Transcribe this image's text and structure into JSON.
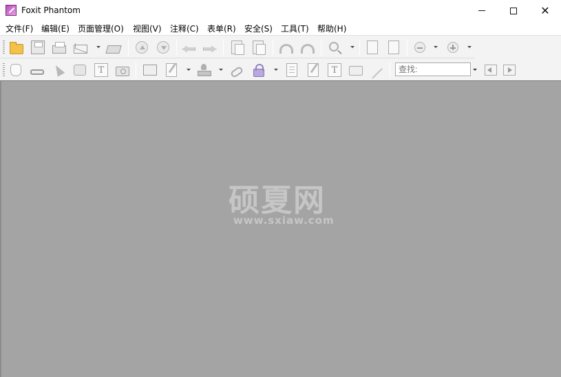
{
  "window": {
    "title": "Foxit Phantom",
    "controls": {
      "minimize": "minimize",
      "maximize": "maximize",
      "close": "✕"
    }
  },
  "menu": [
    "文件(F)",
    "编辑(E)",
    "页面管理(O)",
    "视图(V)",
    "注释(C)",
    "表单(R)",
    "安全(S)",
    "工具(T)",
    "帮助(H)"
  ],
  "toolbar": {
    "search": {
      "placeholder": "查找:"
    }
  },
  "watermark": {
    "title": "硕夏网",
    "url": "www.sxiaw.com"
  }
}
